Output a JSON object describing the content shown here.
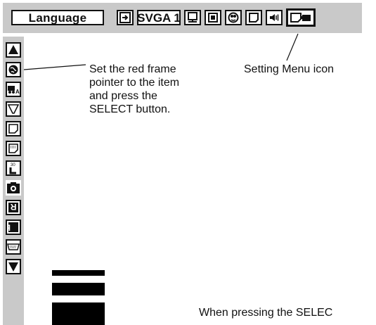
{
  "menu_bar": {
    "language_label": "Language",
    "source_label": "SVGA 1",
    "icons": [
      "input-icon",
      "source-display",
      "pc-adjust-icon",
      "image-select-icon",
      "image-adjust-icon",
      "screen-icon",
      "sound-icon",
      "setting-menu-icon"
    ]
  },
  "sidebar": {
    "items": [
      "up-arrow-icon",
      "language-globe-icon",
      "auto-pc-adjust-icon",
      "keystone-icon",
      "blue-back-icon",
      "display-icon",
      "logo-icon",
      "capture-icon",
      "ceiling-icon",
      "rear-icon",
      "terminal-icon",
      "down-arrow-icon"
    ]
  },
  "callouts": {
    "select_instruction": [
      "Set the red frame",
      "pointer to the item",
      "and press the",
      "SELECT button."
    ],
    "setting_menu_icon": "Setting Menu icon",
    "pressing_select": "When pressing the SELEC"
  }
}
